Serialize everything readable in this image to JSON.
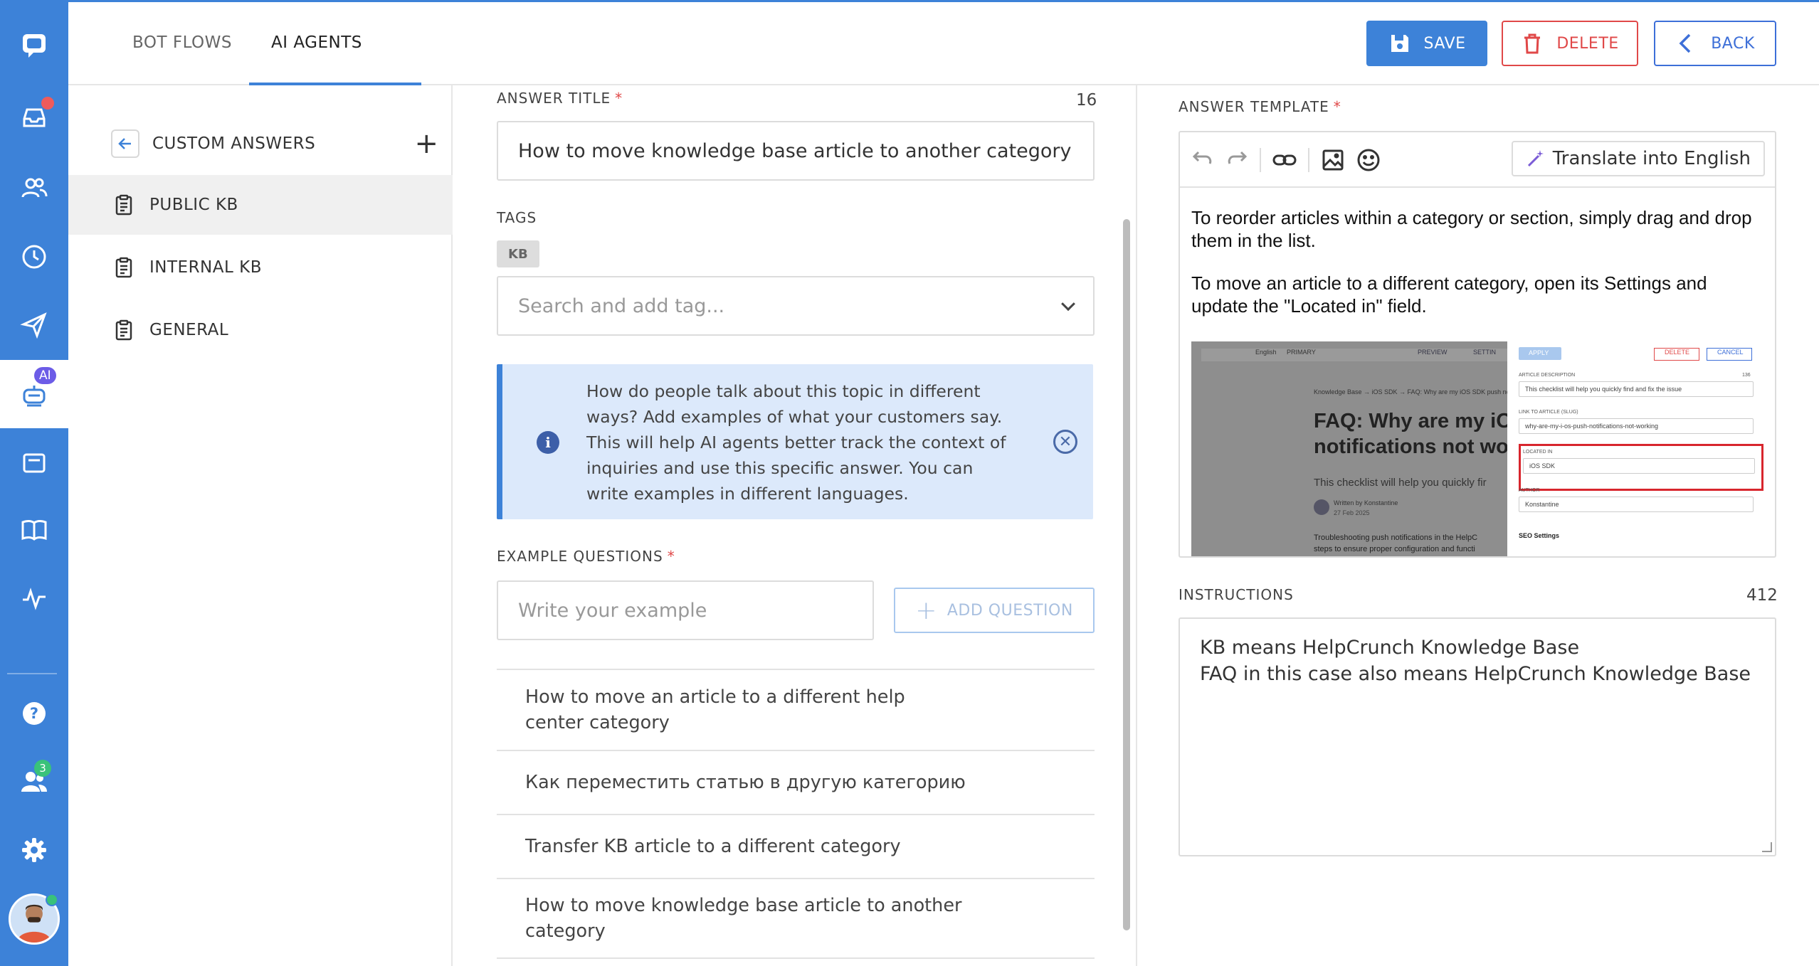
{
  "nav": {
    "ai_badge": "AI",
    "contacts_badge": "3"
  },
  "tabs": [
    {
      "label": "BOT FLOWS",
      "active": false
    },
    {
      "label": "AI AGENTS",
      "active": true
    }
  ],
  "toolbar": {
    "save_label": "SAVE",
    "delete_label": "DELETE",
    "back_label": "BACK"
  },
  "sidebar": {
    "header": "CUSTOM ANSWERS",
    "items": [
      {
        "label": "PUBLIC KB",
        "active": true
      },
      {
        "label": "INTERNAL KB",
        "active": false
      },
      {
        "label": "GENERAL",
        "active": false
      }
    ]
  },
  "form": {
    "answer_title_label": "ANSWER TITLE",
    "answer_title_count": "16",
    "answer_title_value": "How to move knowledge base article to another category",
    "tags_label": "TAGS",
    "tags": [
      "KB"
    ],
    "tag_search_placeholder": "Search and add tag...",
    "info_text": "How do people talk about this topic in different ways? Add examples of what your customers say. This will help AI agents better track the context of inquiries and use this specific answer. You can write examples in different languages.",
    "example_questions_label": "EXAMPLE QUESTIONS",
    "example_placeholder": "Write your example",
    "add_question_label": "ADD QUESTION",
    "questions": [
      "How to move an article to a different help center category",
      "Как переместить статью в другую категорию",
      "Transfer KB article to a different category",
      "How to move knowledge base article to another category"
    ]
  },
  "template": {
    "label": "ANSWER TEMPLATE",
    "translate_label": "Translate into English",
    "paragraphs": [
      "To reorder articles within a category or section, simply drag and drop them in the list.",
      "To move an article to a different category, open its Settings and update the \"Located in\" field."
    ],
    "screenshot": {
      "heading_line1": "FAQ: Why are my iO",
      "heading_line2": "notifications not wo",
      "breadcrumb": "Knowledge Base → iOS SDK → FAQ: Why are my iOS SDK push notifi",
      "subtitle": "This checklist will help you quickly fir",
      "author": "Written by Konstantine",
      "date": "27 Feb 2025",
      "body": "Troubleshooting push notifications in the HelpC",
      "body2": "steps to ensure proper configuration and functi",
      "lang": "English",
      "lang_badge": "PRIMARY",
      "preview": "PREVIEW",
      "settings": "SETTIN",
      "apply": "APPLY",
      "delete": "DELETE",
      "cancel": "CANCEL",
      "desc_label": "ARTICLE DESCRIPTION",
      "desc_count": "136",
      "desc_value": "This checklist will help you quickly find and fix the issue",
      "link_label": "LINK TO ARTICLE (SLUG)",
      "link_value": "why-are-my-i-os-push-notifications-not-working",
      "located_label": "LOCATED IN",
      "located_value": "iOS SDK",
      "author_label": "AUTHOR",
      "author_value": "Konstantine",
      "seo": "SEO Settings"
    }
  },
  "instructions": {
    "label": "INSTRUCTIONS",
    "count": "412",
    "lines": [
      "KB means HelpCrunch Knowledge Base",
      "FAQ in this case also means HelpCrunch Knowledge Base"
    ]
  }
}
